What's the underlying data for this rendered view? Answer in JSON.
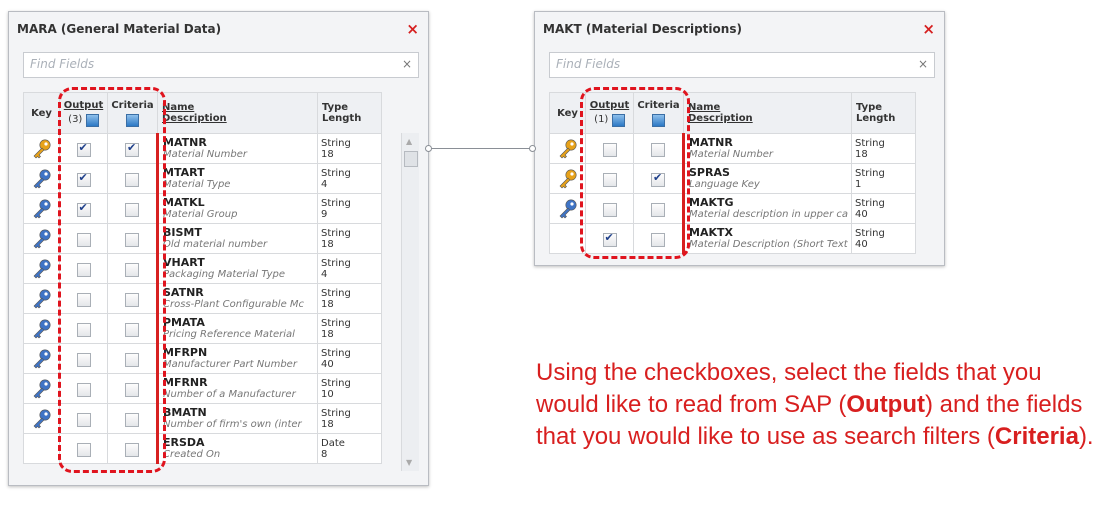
{
  "mara": {
    "title": "MARA (General Material Data)",
    "close": "×",
    "search_placeholder": "Find Fields",
    "search_clear": "×",
    "headers": {
      "key": "Key",
      "output": "Output",
      "output_count": "(3)",
      "criteria": "Criteria",
      "name": "Name",
      "description": "Description",
      "type": "Type",
      "length": "Length"
    },
    "rows": [
      {
        "key": "orange",
        "output": true,
        "criteria": true,
        "name": "MATNR",
        "desc": "Material Number",
        "type": "String",
        "length": "18"
      },
      {
        "key": "blue",
        "output": true,
        "criteria": false,
        "name": "MTART",
        "desc": "Material Type",
        "type": "String",
        "length": "4"
      },
      {
        "key": "blue",
        "output": true,
        "criteria": false,
        "name": "MATKL",
        "desc": "Material Group",
        "type": "String",
        "length": "9"
      },
      {
        "key": "blue",
        "output": false,
        "criteria": false,
        "name": "BISMT",
        "desc": "Old material number",
        "type": "String",
        "length": "18"
      },
      {
        "key": "blue",
        "output": false,
        "criteria": false,
        "name": "VHART",
        "desc": "Packaging Material Type",
        "type": "String",
        "length": "4"
      },
      {
        "key": "blue",
        "output": false,
        "criteria": false,
        "name": "SATNR",
        "desc": "Cross-Plant Configurable Mc",
        "type": "String",
        "length": "18"
      },
      {
        "key": "blue",
        "output": false,
        "criteria": false,
        "name": "PMATA",
        "desc": "Pricing Reference Material",
        "type": "String",
        "length": "18"
      },
      {
        "key": "blue",
        "output": false,
        "criteria": false,
        "name": "MFRPN",
        "desc": "Manufacturer Part Number",
        "type": "String",
        "length": "40"
      },
      {
        "key": "blue",
        "output": false,
        "criteria": false,
        "name": "MFRNR",
        "desc": "Number of a Manufacturer",
        "type": "String",
        "length": "10"
      },
      {
        "key": "blue",
        "output": false,
        "criteria": false,
        "name": "BMATN",
        "desc": "Number of firm's own (inter",
        "type": "String",
        "length": "18"
      },
      {
        "key": "none",
        "output": false,
        "criteria": false,
        "name": "ERSDA",
        "desc": "Created On",
        "type": "Date",
        "length": "8"
      }
    ]
  },
  "makt": {
    "title": "MAKT (Material Descriptions)",
    "close": "×",
    "search_placeholder": "Find Fields",
    "search_clear": "×",
    "headers": {
      "key": "Key",
      "output": "Output",
      "output_count": "(1)",
      "criteria": "Criteria",
      "name": "Name",
      "description": "Description",
      "type": "Type",
      "length": "Length"
    },
    "rows": [
      {
        "key": "orange",
        "output": false,
        "criteria": false,
        "name": "MATNR",
        "desc": "Material Number",
        "type": "String",
        "length": "18"
      },
      {
        "key": "orange",
        "output": false,
        "criteria": true,
        "name": "SPRAS",
        "desc": "Language Key",
        "type": "String",
        "length": "1"
      },
      {
        "key": "blue",
        "output": false,
        "criteria": false,
        "name": "MAKTG",
        "desc": "Material description in upper ca",
        "type": "String",
        "length": "40"
      },
      {
        "key": "none",
        "output": true,
        "criteria": false,
        "name": "MAKTX",
        "desc": "Material Description (Short Text",
        "type": "String",
        "length": "40"
      }
    ]
  },
  "caption": {
    "part1": "Using the checkboxes, select the fields that you would like to read from SAP (",
    "output_word": "Output",
    "part2": ") and the fields that you would like to use as search filters (",
    "criteria_word": "Criteria",
    "part3": ")."
  },
  "colors": {
    "accent_red": "#d81f1f",
    "key_orange": "#e7a21a",
    "key_blue": "#3f74c6"
  }
}
